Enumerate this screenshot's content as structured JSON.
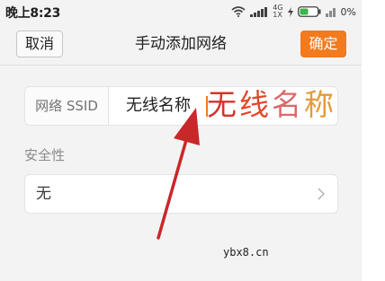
{
  "statusbar": {
    "time": "晚上8:23",
    "network_top": "4G",
    "network_bottom": "1X",
    "battery": "0%",
    "icons": [
      "wifi-icon",
      "signal-icon",
      "charging-icon",
      "battery-icon",
      "signal-icon"
    ]
  },
  "header": {
    "cancel_label": "取消",
    "title": "手动添加网络",
    "confirm_label": "确定"
  },
  "form": {
    "ssid_label": "网络 SSID",
    "ssid_value": "无线名称",
    "security_label": "安全性",
    "security_value": "无"
  },
  "annotation": {
    "chars": [
      "无",
      "线",
      "名",
      "称"
    ],
    "colors": [
      "#d8322a",
      "#e1482c",
      "#d96a6a",
      "#e59a38"
    ],
    "arrow_color": "#c8282a"
  },
  "colors": {
    "accent": "#f37a1d",
    "background": "#f3f3f3"
  },
  "watermark": "ybx8.cn"
}
